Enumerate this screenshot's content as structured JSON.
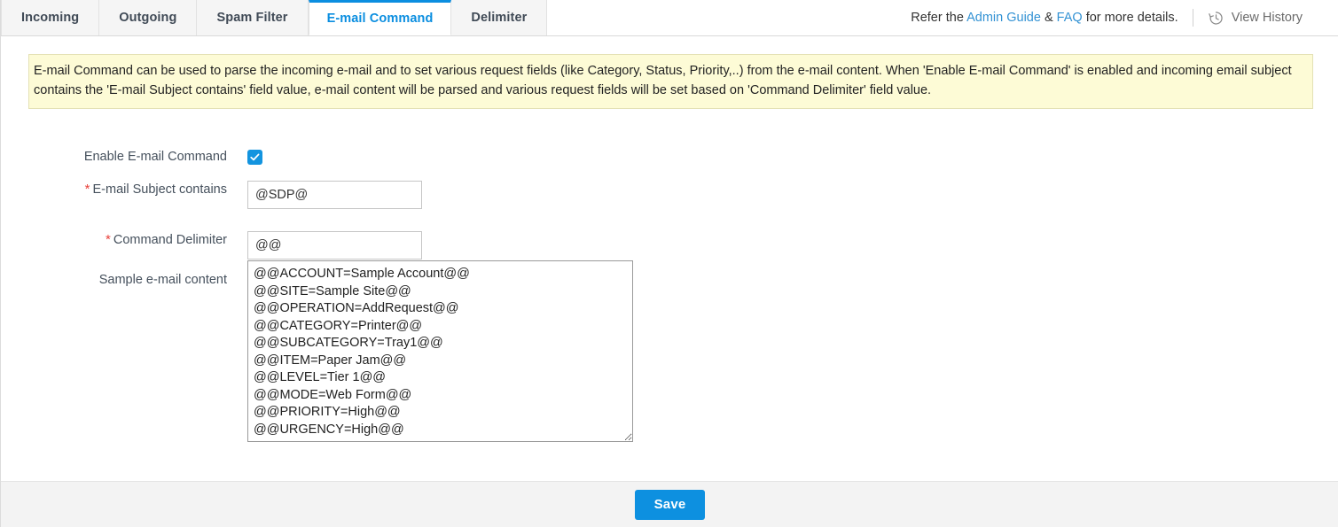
{
  "tabs": [
    {
      "label": "Incoming",
      "active": false
    },
    {
      "label": "Outgoing",
      "active": false
    },
    {
      "label": "Spam Filter",
      "active": false
    },
    {
      "label": "E-mail Command",
      "active": true
    },
    {
      "label": "Delimiter",
      "active": false
    }
  ],
  "header": {
    "refer_prefix": "Refer the ",
    "admin_guide_link": "Admin Guide",
    "refer_amp": " & ",
    "faq_link": "FAQ",
    "refer_suffix": " for more details.",
    "view_history_label": "View History",
    "history_icon": "history-clock-icon",
    "link_color": "#3392d4"
  },
  "notice": {
    "text": "E-mail Command can be used to parse the incoming e-mail and to set various request fields (like Category, Status, Priority,..) from the e-mail content. When 'Enable E-mail Command' is enabled and incoming email subject contains the 'E-mail Subject contains' field value, e-mail content will be parsed and various request fields will be set based on 'Command Delimiter' field value.",
    "background": "#fdfbd6",
    "border_color": "#e4e1b5"
  },
  "form": {
    "enable_command": {
      "label": "Enable E-mail Command",
      "checked": true,
      "check_color": "#1394df"
    },
    "subject_contains": {
      "label": "E-mail Subject contains",
      "required": true,
      "value": "@SDP@",
      "placeholder": ""
    },
    "command_delimiter": {
      "label": "Command Delimiter",
      "required": true,
      "value": "@@",
      "placeholder": ""
    },
    "sample_content": {
      "label": "Sample e-mail content",
      "required": false,
      "value": "@@ACCOUNT=Sample Account@@\n@@SITE=Sample Site@@\n@@OPERATION=AddRequest@@\n@@CATEGORY=Printer@@\n@@SUBCATEGORY=Tray1@@\n@@ITEM=Paper Jam@@\n@@LEVEL=Tier 1@@\n@@MODE=Web Form@@\n@@PRIORITY=High@@\n@@URGENCY=High@@",
      "placeholder": ""
    },
    "required_marker": "*",
    "required_color": "#e8403a"
  },
  "footer": {
    "save_label": "Save",
    "save_color": "#0d90e0"
  }
}
